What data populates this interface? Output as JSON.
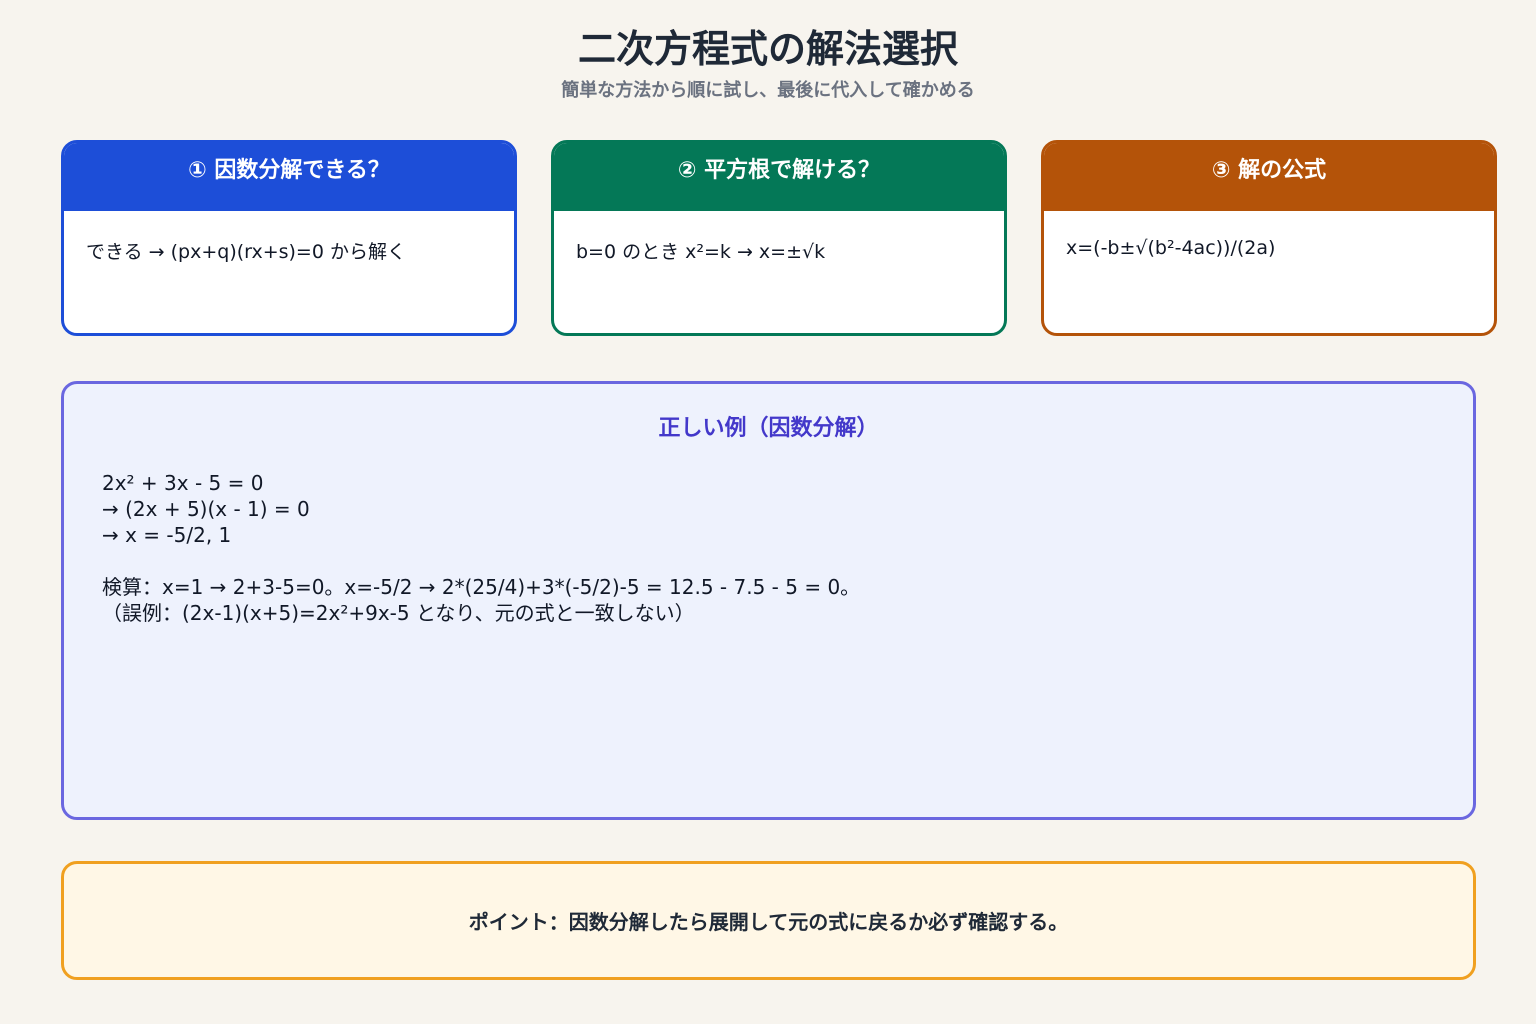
{
  "header": {
    "title": "二次方程式の解法選択",
    "subtitle": "簡単な方法から順に試し、最後に代入して確かめる"
  },
  "methods": [
    {
      "title": "① 因数分解できる？",
      "body": "できる → (px+q)(rx+s)=0 から解く",
      "color": "#1d4ed8"
    },
    {
      "title": "② 平方根で解ける？",
      "body": "b=0 のとき x²=k → x=±√k",
      "color": "#047857"
    },
    {
      "title": "③ 解の公式",
      "body": "x=(-b±√(b²-4ac))/(2a)",
      "color": "#b45309"
    }
  ],
  "example": {
    "title": "正しい例（因数分解）",
    "lines": [
      "2x² + 3x - 5 = 0",
      "→ (2x + 5)(x - 1) = 0",
      "→ x = -5/2, 1"
    ],
    "check": [
      "検算：x=1 → 2+3-5=0。x=-5/2 → 2*(25/4)+3*(-5/2)-5 = 12.5 - 7.5 - 5 = 0。",
      "（誤例：(2x-1)(x+5)=2x²+9x-5 となり、元の式と一致しない）"
    ],
    "border_color": "#6a67e0"
  },
  "point": {
    "text": "ポイント：因数分解したら展開して元の式に戻るか必ず確認する。",
    "border_color": "#f0a020"
  }
}
